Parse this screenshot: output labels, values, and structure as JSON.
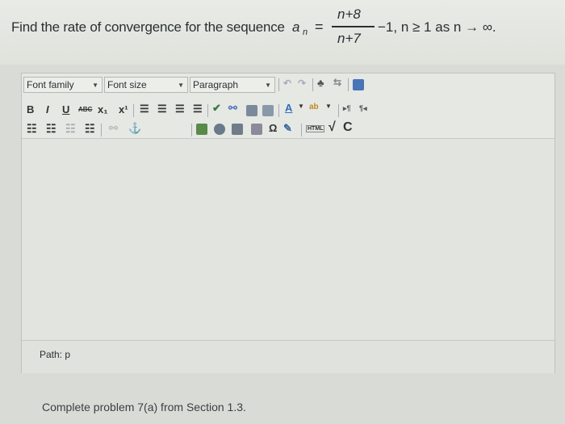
{
  "question": {
    "prefix": "Find the rate of convergence for the sequence",
    "variable": "a",
    "subscript": "n",
    "equals": "=",
    "numerator": "n+8",
    "denominator": "n+7",
    "suffix": "−1, n ≥ 1 as n → ∞."
  },
  "toolbar": {
    "font_family": "Font family",
    "font_size": "Font size",
    "format": "Paragraph",
    "bold": "B",
    "italic": "I",
    "underline": "U",
    "strike": "ABC",
    "subscript": "x₁",
    "superscript": "x¹",
    "html": "HTML"
  },
  "status": {
    "path": "Path: p"
  },
  "footer": {
    "instruction": "Complete problem 7(a) from Section 1.3."
  },
  "colors": {
    "text_color": "#2f6fc0",
    "highlight": "#e0a23a"
  }
}
